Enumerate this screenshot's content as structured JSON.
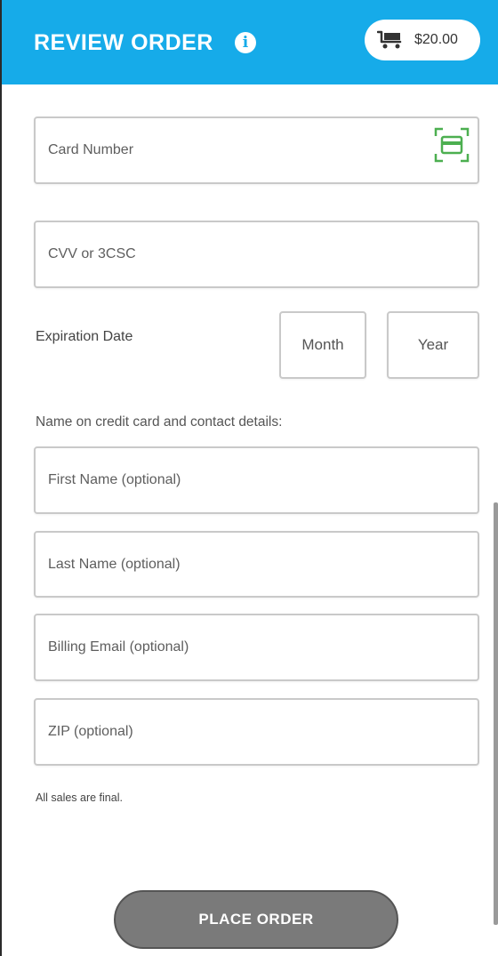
{
  "header": {
    "title": "REVIEW ORDER",
    "info_icon": "info-icon",
    "cart": {
      "icon": "shopping-cart-icon",
      "total": "$20.00"
    },
    "background_color": "#16abe9"
  },
  "payment": {
    "card_number": {
      "placeholder": "Card Number",
      "value": "",
      "scan_icon": "card-scan-icon",
      "scan_icon_color": "#4caf50"
    },
    "cvv": {
      "placeholder": "CVV or 3CSC",
      "value": ""
    },
    "expiration": {
      "label": "Expiration Date",
      "month_placeholder": "Month",
      "year_placeholder": "Year"
    }
  },
  "contact": {
    "label": "Name on credit card and contact details:",
    "first_name": {
      "placeholder": "First Name (optional)",
      "value": ""
    },
    "last_name": {
      "placeholder": "Last Name (optional)",
      "value": ""
    },
    "billing_email": {
      "placeholder": "Billing Email (optional)",
      "value": ""
    },
    "zip": {
      "placeholder": "ZIP (optional)",
      "value": ""
    }
  },
  "disclaimer": "All sales are final.",
  "place_order": {
    "label": "PLACE ORDER",
    "color": "#7a7a7a"
  }
}
